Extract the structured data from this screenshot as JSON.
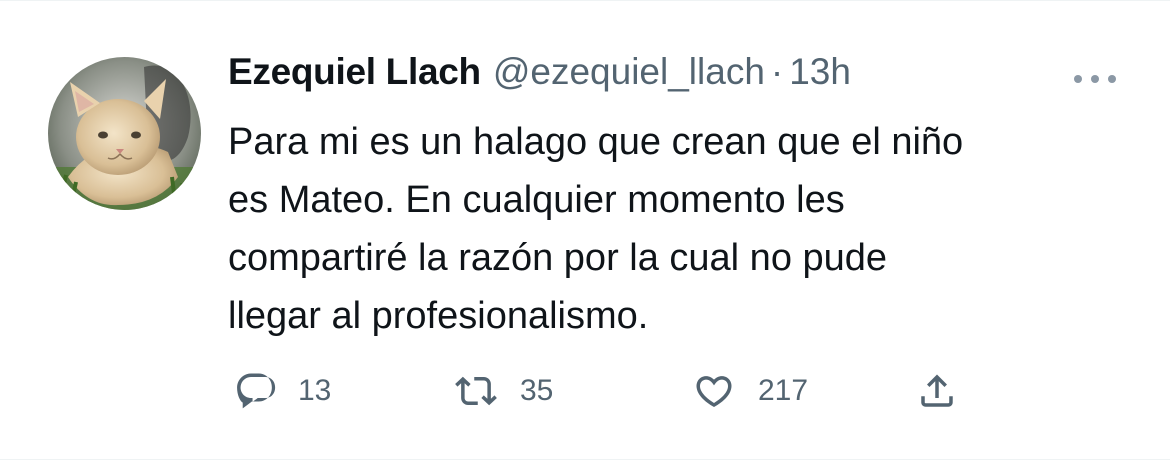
{
  "tweet": {
    "display_name": "Ezequiel Llach",
    "handle": "@ezequiel_llach",
    "separator": "·",
    "time": "13h",
    "text_lines": [
      "Para mi es un halago que crean que el niño",
      "es Mateo. En cualquier momento les",
      "compartiré la razón por la cual no pude",
      "llegar al profesionalismo."
    ],
    "avatar_icon": "cat-photo-avatar",
    "more_icon": "more-horizontal-icon"
  },
  "actions": {
    "reply": {
      "icon": "reply-icon",
      "count": "13"
    },
    "retweet": {
      "icon": "retweet-icon",
      "count": "35"
    },
    "like": {
      "icon": "heart-icon",
      "count": "217"
    },
    "share": {
      "icon": "share-icon"
    }
  },
  "colors": {
    "primary_text": "#0f1419",
    "secondary_text": "#536471",
    "background": "#ffffff"
  }
}
